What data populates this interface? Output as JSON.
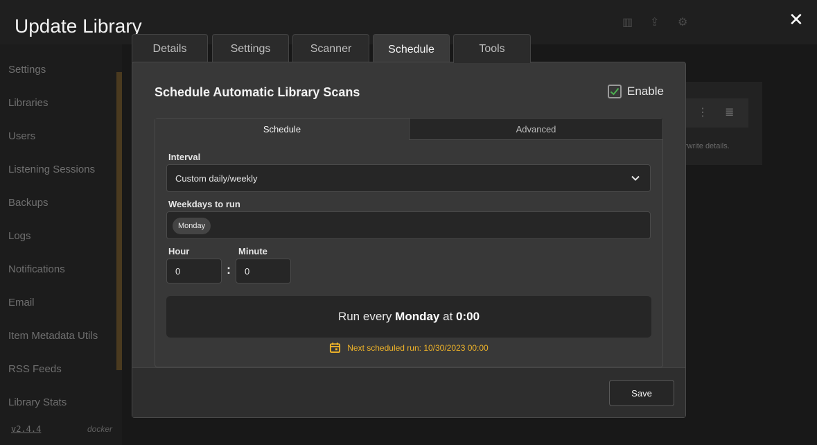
{
  "modal": {
    "title": "Update Library",
    "close_icon": "close-icon",
    "tabs": [
      {
        "label": "Details"
      },
      {
        "label": "Settings"
      },
      {
        "label": "Scanner"
      },
      {
        "label": "Schedule"
      },
      {
        "label": "Tools"
      }
    ],
    "active_tab": "Schedule"
  },
  "schedule": {
    "heading": "Schedule Automatic Library Scans",
    "enable_label": "Enable",
    "enabled": true,
    "subtabs": [
      {
        "label": "Schedule"
      },
      {
        "label": "Advanced"
      }
    ],
    "interval_label": "Interval",
    "interval_value": "Custom daily/weekly",
    "weekdays_label": "Weekdays to run",
    "weekdays": [
      "Monday"
    ],
    "hour_label": "Hour",
    "hour_value": "0",
    "minute_label": "Minute",
    "minute_value": "0",
    "time_separator": ":",
    "summary": {
      "prefix": "Run every ",
      "day": "Monday",
      "middle": " at ",
      "time": "0:00"
    },
    "next_run": "Next scheduled run: 10/30/2023 00:00"
  },
  "footer": {
    "save_label": "Save"
  },
  "background": {
    "sidebar": [
      {
        "label": "Settings"
      },
      {
        "label": "Libraries"
      },
      {
        "label": "Users"
      },
      {
        "label": "Listening Sessions"
      },
      {
        "label": "Backups"
      },
      {
        "label": "Logs"
      },
      {
        "label": "Notifications"
      },
      {
        "label": "Email"
      },
      {
        "label": "Item Metadata Utils"
      },
      {
        "label": "RSS Feeds"
      },
      {
        "label": "Library Stats"
      }
    ],
    "version": "v2.4.4",
    "install": "docker",
    "content_text": "rwrite details."
  },
  "colors": {
    "accent_yellow": "#f0b429",
    "check_green": "#4caf50",
    "modal_bg": "#383838"
  }
}
